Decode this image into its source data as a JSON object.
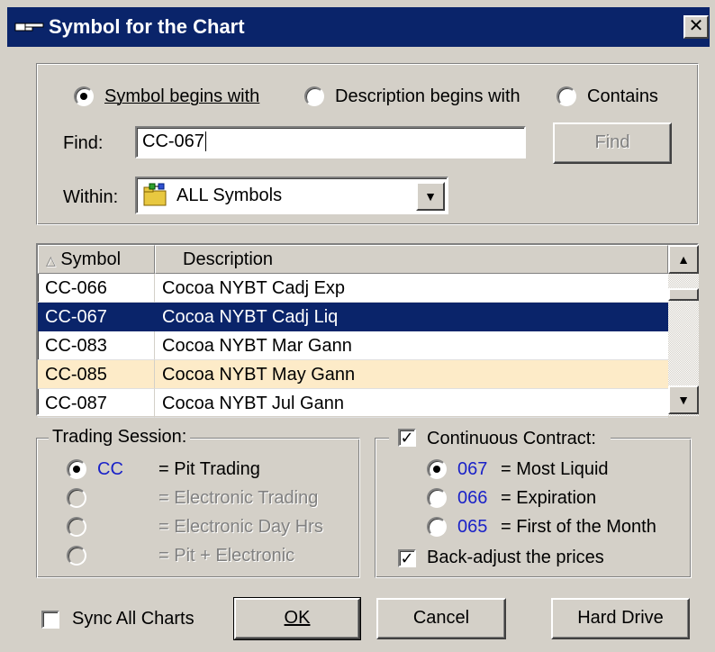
{
  "window": {
    "title": "Symbol for the Chart",
    "close_glyph": "✕",
    "title_icon": "pointing-hand-icon"
  },
  "search": {
    "mode_options": [
      {
        "label": "Symbol begins with",
        "selected": true
      },
      {
        "label": "Description begins with",
        "selected": false
      },
      {
        "label": "Contains",
        "selected": false
      }
    ],
    "find_label": "Find:",
    "find_value": "CC-067",
    "find_button": "Find",
    "within_label": "Within:",
    "within_value": "ALL Symbols",
    "within_icon": "folder-tree-icon"
  },
  "table": {
    "columns": [
      "Symbol",
      "Description"
    ],
    "sort_indicator": "△",
    "rows": [
      {
        "symbol": "CC-066",
        "description": "Cocoa NYBT Cadj Exp",
        "state": "normal"
      },
      {
        "symbol": "CC-067",
        "description": "Cocoa NYBT Cadj Liq",
        "state": "selected"
      },
      {
        "symbol": "CC-083",
        "description": "Cocoa NYBT Mar Gann",
        "state": "normal"
      },
      {
        "symbol": "CC-085",
        "description": "Cocoa NYBT May Gann",
        "state": "highlight"
      },
      {
        "symbol": "CC-087",
        "description": "Cocoa NYBT Jul Gann",
        "state": "normal"
      }
    ]
  },
  "trading_session": {
    "caption": "Trading Session:",
    "options": [
      {
        "code": "CC",
        "label": "= Pit Trading",
        "selected": true,
        "enabled": true
      },
      {
        "code": "",
        "label": "= Electronic Trading",
        "selected": false,
        "enabled": false
      },
      {
        "code": "",
        "label": "= Electronic Day Hrs",
        "selected": false,
        "enabled": false
      },
      {
        "code": "",
        "label": "= Pit + Electronic",
        "selected": false,
        "enabled": false
      }
    ]
  },
  "continuous_contract": {
    "caption": "Continuous Contract:",
    "checked": true,
    "options": [
      {
        "code": "067",
        "label": "= Most Liquid",
        "selected": true
      },
      {
        "code": "066",
        "label": "= Expiration",
        "selected": false
      },
      {
        "code": "065",
        "label": "= First of the Month",
        "selected": false
      }
    ],
    "back_adjust_label": "Back-adjust the prices",
    "back_adjust_checked": true
  },
  "footer": {
    "sync_label": "Sync All Charts",
    "sync_checked": false,
    "ok_label": "OK",
    "cancel_label": "Cancel",
    "hard_drive_label": "Hard Drive"
  },
  "colors": {
    "title_bar": "#0a246a",
    "selection": "#0a246a",
    "highlight": "#fdebc8",
    "code_text": "#1a22c8"
  }
}
